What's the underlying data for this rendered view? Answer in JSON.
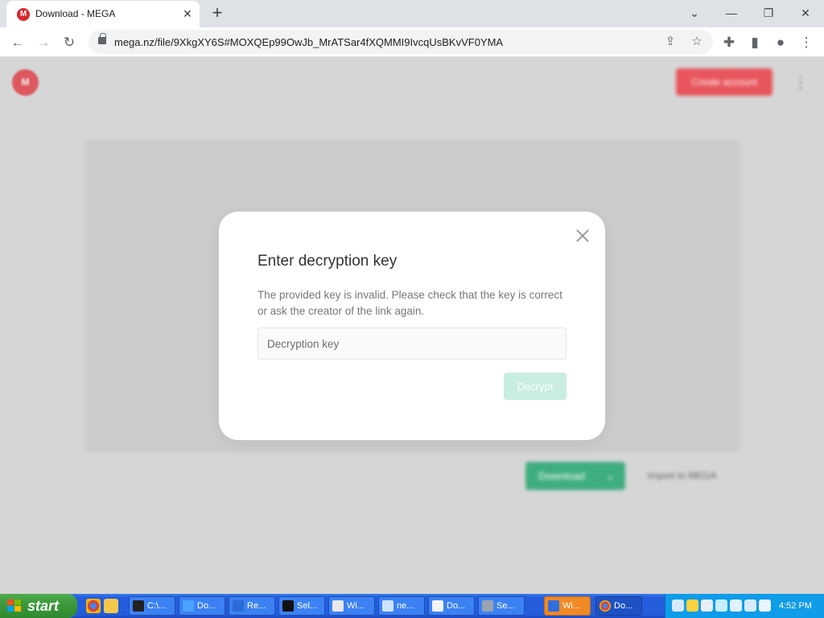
{
  "browser": {
    "tab_favicon": "M",
    "tab_title": "Download - MEGA",
    "tab_close_icon": "close-icon",
    "new_tab_icon": "plus-icon",
    "url": "mega.nz/file/9XkgXY6S#MOXQEp99OwJb_MrATSar4fXQMMI9IvcqUsBKvVF0YMA"
  },
  "page": {
    "logo_text": "M",
    "create_account_label": "Create account",
    "download_label": "Download",
    "import_label": "Import to MEGA"
  },
  "dialog": {
    "title": "Enter decryption key",
    "message": "The provided key is invalid. Please check that the key is correct or ask the creator of the link again.",
    "input_placeholder": "Decryption key",
    "input_value": "",
    "decrypt_label": "Decrypt",
    "accent_color": "#c9ede0"
  },
  "taskbar": {
    "start_label": "start",
    "tasks": [
      {
        "label": "C:\\...",
        "icon": "7zip-icon"
      },
      {
        "label": "Do...",
        "icon": "download-icon"
      },
      {
        "label": "Re...",
        "icon": "table-icon"
      },
      {
        "label": "Sel...",
        "icon": "console-icon"
      },
      {
        "label": "Wi...",
        "icon": "window-icon"
      },
      {
        "label": "ne...",
        "icon": "notepad-icon"
      },
      {
        "label": "Do...",
        "icon": "document-icon"
      },
      {
        "label": "Se...",
        "icon": "settings-icon"
      },
      {
        "label": "Wi...",
        "icon": "shield-icon"
      },
      {
        "label": "Do...",
        "icon": "chrome-icon"
      }
    ],
    "clock": "4:52 PM"
  }
}
